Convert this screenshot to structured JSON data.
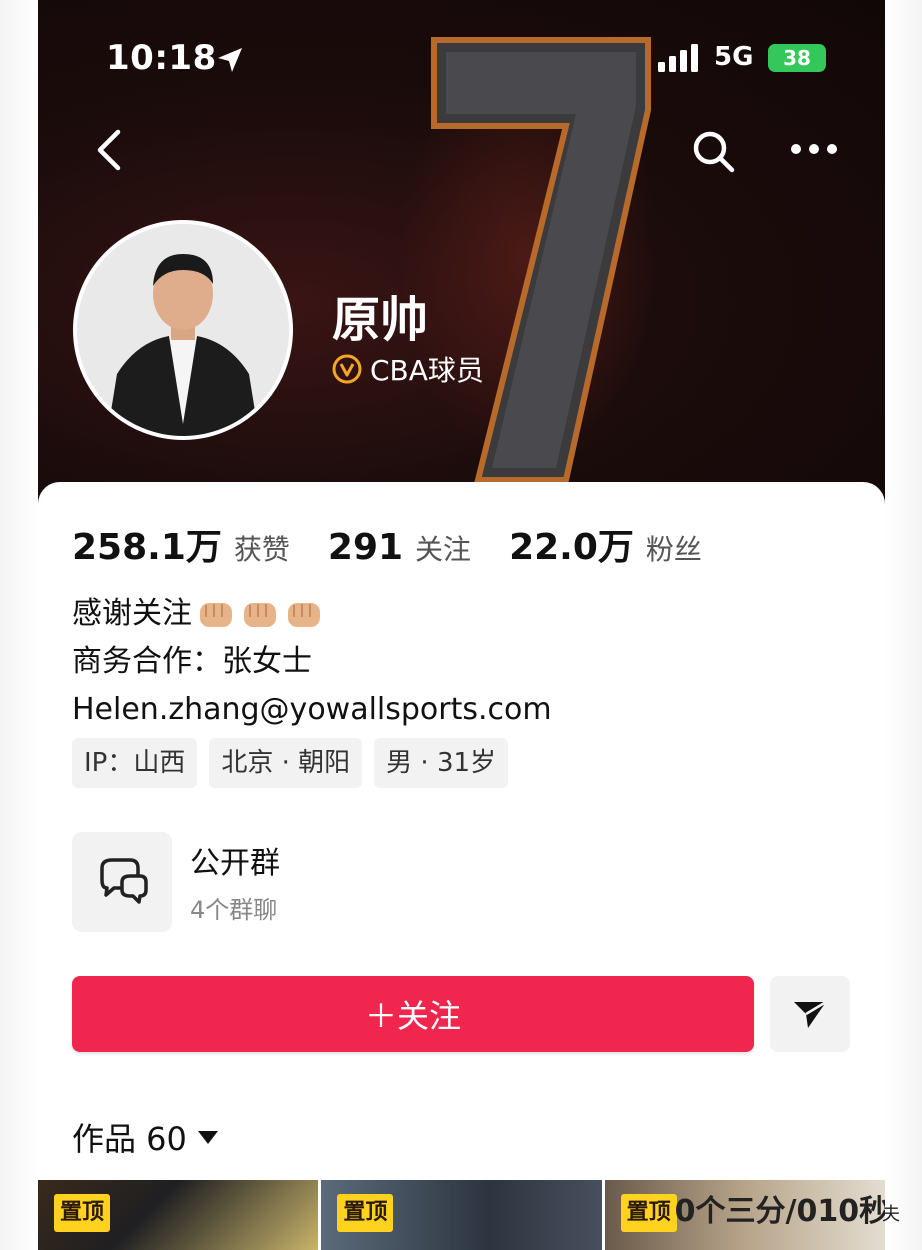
{
  "status_bar": {
    "time": "10:18",
    "network": "5G",
    "battery": "38"
  },
  "profile": {
    "name": "原帅",
    "verification": "CBA球员",
    "jersey_number": "7"
  },
  "stats": [
    {
      "value": "258.1万",
      "label": "获赞"
    },
    {
      "value": "291",
      "label": "关注"
    },
    {
      "value": "22.0万",
      "label": "粉丝"
    }
  ],
  "bio": {
    "line1": "感谢关注",
    "line2": "商务合作：张女士",
    "line3": "Helen.zhang@yowallsports.com"
  },
  "tags": [
    "IP：山西",
    "北京 · 朝阳",
    "男 · 31岁"
  ],
  "group": {
    "title": "公开群",
    "subtitle": "4个群聊"
  },
  "actions": {
    "follow_label": "＋关注"
  },
  "works": {
    "label": "作品 60"
  },
  "thumbnails": [
    {
      "pin": "置顶",
      "overlay": ""
    },
    {
      "pin": "置顶",
      "overlay": ""
    },
    {
      "pin": "置顶",
      "overlay": "0个三分/010秒"
    }
  ],
  "watermark": "夫",
  "colors": {
    "follow_button": "#f0264e",
    "battery": "#34c759",
    "pin_badge": "#ffd21f",
    "verify_badge": "#f5a623"
  }
}
